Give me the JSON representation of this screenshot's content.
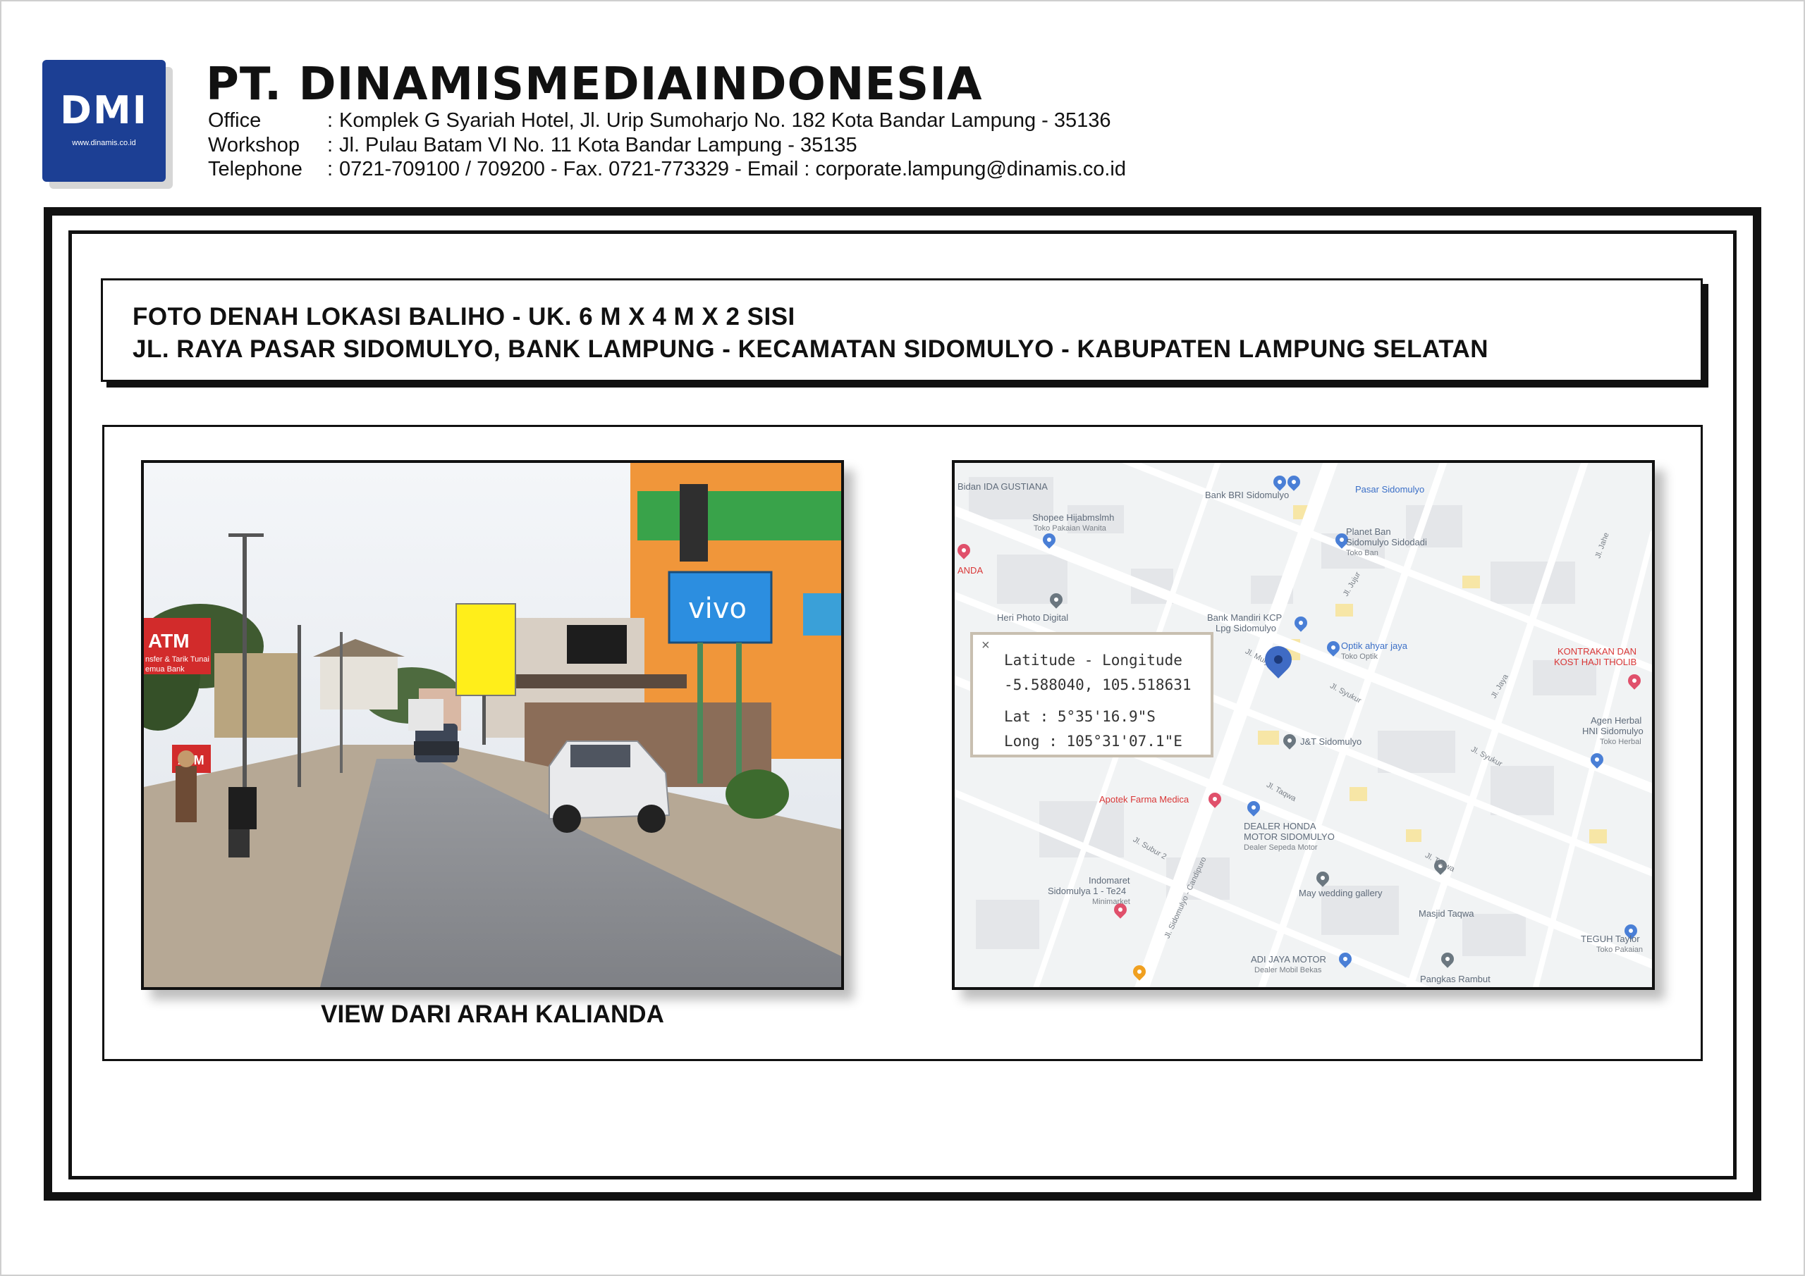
{
  "company": {
    "logo_text": "DMI",
    "logo_url": "www.dinamis.co.id",
    "name": "PT. DINAMISMEDIAINDONESIA",
    "office_label": "Office",
    "office_value": "Komplek G Syariah Hotel, Jl. Urip   Sumoharjo No. 182 Kota Bandar Lampung - 35136",
    "workshop_label": "Workshop",
    "workshop_value": "Jl. Pulau Batam   VI No.  11 Kota Bandar Lampung - 35135",
    "telephone_label": "Telephone",
    "telephone_value": "0721-709100 / 709200 - Fax. 0721-773329 - Email : corporate.lampung@dinamis.co.id",
    "separator": ":"
  },
  "title": {
    "line1": "FOTO DENAH LOKASI BALIHO - UK. 6 M X 4 M X 2 SISI",
    "line2": "JL. RAYA PASAR SIDOMULYO, BANK LAMPUNG - KECAMATAN SIDOMULYO - KABUPATEN LAMPUNG SELATAN"
  },
  "photo": {
    "caption": "VIEW DARI ARAH KALIANDA",
    "signs": {
      "atm": "ATM",
      "atm_sub": "nsfer & Tarik Tunai",
      "atm_bank": "emua Bank",
      "atm2": "ATM",
      "vivo": "vivo"
    }
  },
  "map": {
    "labels": {
      "bidan": "Bidan IDA GUSTIANA",
      "bank_bri": "Bank BRI Sidomulyo",
      "pasar": "Pasar Sidomulyo",
      "shopee": "Shopee Hijabmslmh",
      "shopee_sub": "Toko Pakaian Wanita",
      "planet": "Planet Ban",
      "planet2": "Sidomulyo Sidodadi",
      "planet_sub": "Toko Ban",
      "anda": "ANDA",
      "heri": "Heri Photo Digital",
      "mandiri": "Bank Mandiri KCP",
      "mandiri2": "Lpg Sidomulyo",
      "optik": "Optik ahyar jaya",
      "optik_sub": "Toko Optik",
      "kontrakan": "KONTRAKAN DAN",
      "kontrakan2": "KOST HAJI THOLIB",
      "jt": "J&T Sidomulyo",
      "agen": "Agen Herbal",
      "agen2": "HNI Sidomulyo",
      "agen_sub": "Toko Herbal",
      "apotek": "Apotek Farma Medica",
      "dealer_honda": "DEALER HONDA",
      "dealer_honda2": "MOTOR SIDOMULYO",
      "dealer_honda_sub": "Dealer Sepeda Motor",
      "indomaret": "Indomaret",
      "indomaret2": "Sidomulya 1 - Te24",
      "indomaret_sub": "Minimarket",
      "may": "May wedding gallery",
      "masjid": "Masjid Taqwa",
      "teguh": "TEGUH Taylor",
      "teguh_sub": "Toko Pakaian",
      "adi": "ADI JAYA MOTOR",
      "adi_sub": "Dealer Mobil Bekas",
      "pangkas": "Pangkas Rambut",
      "jl_mulya": "Jl. Mulya",
      "jl_syukur": "Jl. Syukur",
      "jl_syukur2": "Jl. Syukur",
      "jl_taqwa": "Jl. Taqwa",
      "jl_taqwa2": "Jl. Taqwa",
      "jl_jujur": "Jl. Jujur",
      "jl_jaya": "Jl. Jaya",
      "jl_jahe": "Jl. Jahe",
      "jl_subur": "Jl. Subur 2",
      "jl_sidomulyo": "Jl. Sidomulyo - Candipuro"
    },
    "card": {
      "close": "×",
      "heading": "Latitude - Longitude",
      "decimal": "-5.588040, 105.518631",
      "lat": "Lat : 5°35'16.9\"S",
      "long": "Long : 105°31'07.1\"E"
    }
  }
}
